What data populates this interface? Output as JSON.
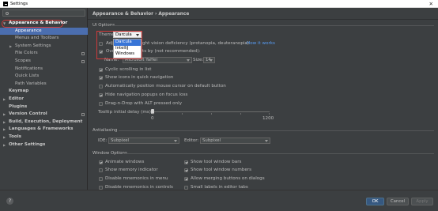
{
  "window": {
    "title": "Settings"
  },
  "sidebar": {
    "search_placeholder": "",
    "items": [
      {
        "label": "Appearance & Behavior"
      },
      {
        "label": "Appearance"
      },
      {
        "label": "Menus and Toolbars"
      },
      {
        "label": "System Settings"
      },
      {
        "label": "File Colors"
      },
      {
        "label": "Scopes"
      },
      {
        "label": "Notifications"
      },
      {
        "label": "Quick Lists"
      },
      {
        "label": "Path Variables"
      },
      {
        "label": "Keymap"
      },
      {
        "label": "Editor"
      },
      {
        "label": "Plugins"
      },
      {
        "label": "Version Control"
      },
      {
        "label": "Build, Execution, Deployment"
      },
      {
        "label": "Languages & Frameworks"
      },
      {
        "label": "Tools"
      },
      {
        "label": "Other Settings"
      }
    ]
  },
  "main": {
    "breadcrumb": "Appearance & Behavior › Appearance",
    "ui_options": {
      "title": "UI Options",
      "theme_label": "Theme:",
      "theme_value": "Darcula",
      "theme_options": [
        "Darcula",
        "IntelliJ",
        "Windows"
      ],
      "adjust_label_visible": "ght vision deficiency (protanopia, deuteranopia)",
      "how_it_works": "How it works",
      "override_label_visible": "ts by (not recommended):",
      "adjust_prefix": "Adj",
      "override_prefix": "Ove",
      "name_label": "Name:",
      "name_value": "Microsoft YaHei",
      "size_label": "Size:",
      "size_value": "14",
      "checkboxes": [
        {
          "label": "Cyclic scrolling in list",
          "checked": true
        },
        {
          "label": "Show icons in quick navigation",
          "checked": true
        },
        {
          "label": "Automatically position mouse cursor on default button",
          "checked": false
        },
        {
          "label": "Hide navigation popups on focus loss",
          "checked": true
        },
        {
          "label": "Drag-n-Drop with ALT pressed only",
          "checked": false
        }
      ],
      "tooltip_label": "Tooltip initial delay (ms):",
      "tooltip_min": "0",
      "tooltip_max": "1200",
      "tooltip_value": 0
    },
    "antialiasing": {
      "title": "Antialiasing",
      "ide_label": "IDE:",
      "ide_value": "Subpixel",
      "editor_label": "Editor:",
      "editor_value": "Subpixel"
    },
    "window_options": {
      "title": "Window Options",
      "left": [
        {
          "label": "Animate windows",
          "checked": true
        },
        {
          "label": "Show memory indicator",
          "checked": false
        },
        {
          "label": "Disable mnemonics in menu",
          "checked": false
        },
        {
          "label": "Disable mnemonics in controls",
          "checked": false
        }
      ],
      "right": [
        {
          "label": "Show tool window bars",
          "checked": true
        },
        {
          "label": "Show tool window numbers",
          "checked": true
        },
        {
          "label": "Allow merging buttons on dialogs",
          "checked": true
        },
        {
          "label": "Small labels in editor tabs",
          "checked": false
        }
      ]
    }
  },
  "footer": {
    "help": "?",
    "ok": "OK",
    "cancel": "Cancel",
    "apply": "Apply"
  },
  "colors": {
    "background": "#3c3f41",
    "selection": "#4b6eaf",
    "highlight": "#d03a3a",
    "link": "#589df6"
  }
}
